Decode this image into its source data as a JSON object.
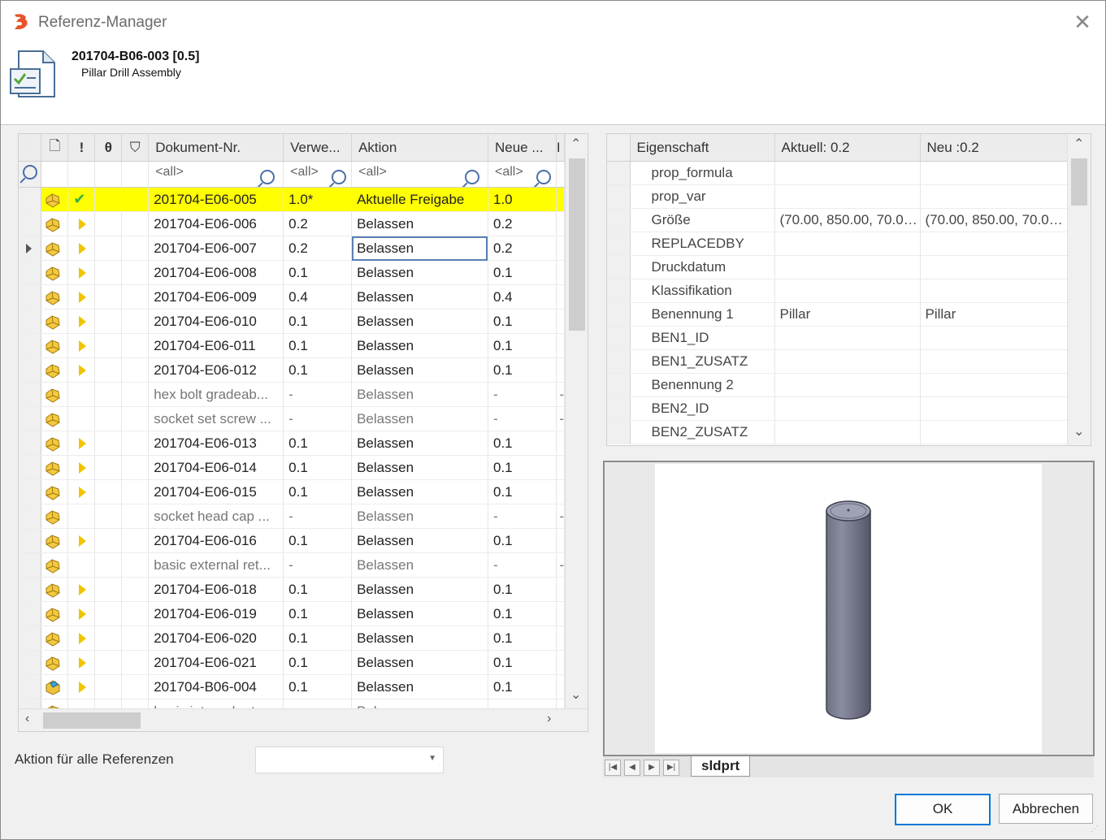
{
  "window": {
    "title": "Referenz-Manager",
    "close_glyph": "✕"
  },
  "header": {
    "document_number": "201704-B06-003 [0.5]",
    "document_name": "Pillar Drill Assembly"
  },
  "references_grid": {
    "columns": {
      "doc_icon": "🗋",
      "warn": "!",
      "lock": "θ",
      "filter": "⛉",
      "doc_nr": "Dokument-Nr.",
      "version": "Verwe...",
      "action": "Aktion",
      "new": "Neue ...",
      "extra": "I"
    },
    "filter": {
      "doc_nr": "<all>",
      "version": "<all>",
      "action": "<all>",
      "new": "<all>"
    },
    "rows": [
      {
        "doc_nr": "201704-E06-005",
        "version": "1.0*",
        "action": "Aktuelle Freigabe",
        "new": "1.0",
        "extra": "",
        "status": "check",
        "highlight": true,
        "current": false,
        "icon": "part-yellow",
        "dim": false
      },
      {
        "doc_nr": "201704-E06-006",
        "version": "0.2",
        "action": "Belassen",
        "new": "0.2",
        "extra": "",
        "status": "arrow",
        "highlight": false,
        "current": false,
        "icon": "part-yellow",
        "dim": false
      },
      {
        "doc_nr": "201704-E06-007",
        "version": "0.2",
        "action": "Belassen",
        "new": "0.2",
        "extra": "",
        "status": "arrow",
        "highlight": false,
        "current": true,
        "icon": "part-yellow",
        "dim": false
      },
      {
        "doc_nr": "201704-E06-008",
        "version": "0.1",
        "action": "Belassen",
        "new": "0.1",
        "extra": "",
        "status": "arrow",
        "highlight": false,
        "current": false,
        "icon": "part-yellow",
        "dim": false
      },
      {
        "doc_nr": "201704-E06-009",
        "version": "0.4",
        "action": "Belassen",
        "new": "0.4",
        "extra": "",
        "status": "arrow",
        "highlight": false,
        "current": false,
        "icon": "part-yellow",
        "dim": false
      },
      {
        "doc_nr": "201704-E06-010",
        "version": "0.1",
        "action": "Belassen",
        "new": "0.1",
        "extra": "",
        "status": "arrow",
        "highlight": false,
        "current": false,
        "icon": "part-yellow",
        "dim": false
      },
      {
        "doc_nr": "201704-E06-011",
        "version": "0.1",
        "action": "Belassen",
        "new": "0.1",
        "extra": "",
        "status": "arrow",
        "highlight": false,
        "current": false,
        "icon": "part-yellow",
        "dim": false
      },
      {
        "doc_nr": "201704-E06-012",
        "version": "0.1",
        "action": "Belassen",
        "new": "0.1",
        "extra": "",
        "status": "arrow",
        "highlight": false,
        "current": false,
        "icon": "part-yellow",
        "dim": false
      },
      {
        "doc_nr": "hex bolt gradeab...",
        "version": "-",
        "action": "Belassen",
        "new": "-",
        "extra": "-",
        "status": "",
        "highlight": false,
        "current": false,
        "icon": "part-yellow",
        "dim": true
      },
      {
        "doc_nr": "socket set screw ...",
        "version": "-",
        "action": "Belassen",
        "new": "-",
        "extra": "-",
        "status": "",
        "highlight": false,
        "current": false,
        "icon": "part-yellow",
        "dim": true
      },
      {
        "doc_nr": "201704-E06-013",
        "version": "0.1",
        "action": "Belassen",
        "new": "0.1",
        "extra": "",
        "status": "arrow",
        "highlight": false,
        "current": false,
        "icon": "part-yellow",
        "dim": false
      },
      {
        "doc_nr": "201704-E06-014",
        "version": "0.1",
        "action": "Belassen",
        "new": "0.1",
        "extra": "",
        "status": "arrow",
        "highlight": false,
        "current": false,
        "icon": "part-yellow",
        "dim": false
      },
      {
        "doc_nr": "201704-E06-015",
        "version": "0.1",
        "action": "Belassen",
        "new": "0.1",
        "extra": "",
        "status": "arrow",
        "highlight": false,
        "current": false,
        "icon": "part-yellow",
        "dim": false
      },
      {
        "doc_nr": "socket head cap ...",
        "version": "-",
        "action": "Belassen",
        "new": "-",
        "extra": "-",
        "status": "",
        "highlight": false,
        "current": false,
        "icon": "part-yellow",
        "dim": true
      },
      {
        "doc_nr": "201704-E06-016",
        "version": "0.1",
        "action": "Belassen",
        "new": "0.1",
        "extra": "",
        "status": "arrow",
        "highlight": false,
        "current": false,
        "icon": "part-yellow",
        "dim": false
      },
      {
        "doc_nr": "basic external ret...",
        "version": "-",
        "action": "Belassen",
        "new": "-",
        "extra": "-",
        "status": "",
        "highlight": false,
        "current": false,
        "icon": "part-yellow",
        "dim": true
      },
      {
        "doc_nr": "201704-E06-018",
        "version": "0.1",
        "action": "Belassen",
        "new": "0.1",
        "extra": "",
        "status": "arrow",
        "highlight": false,
        "current": false,
        "icon": "part-yellow",
        "dim": false
      },
      {
        "doc_nr": "201704-E06-019",
        "version": "0.1",
        "action": "Belassen",
        "new": "0.1",
        "extra": "",
        "status": "arrow",
        "highlight": false,
        "current": false,
        "icon": "part-yellow",
        "dim": false
      },
      {
        "doc_nr": "201704-E06-020",
        "version": "0.1",
        "action": "Belassen",
        "new": "0.1",
        "extra": "",
        "status": "arrow",
        "highlight": false,
        "current": false,
        "icon": "part-yellow",
        "dim": false
      },
      {
        "doc_nr": "201704-E06-021",
        "version": "0.1",
        "action": "Belassen",
        "new": "0.1",
        "extra": "",
        "status": "arrow",
        "highlight": false,
        "current": false,
        "icon": "part-yellow",
        "dim": false
      },
      {
        "doc_nr": "201704-B06-004",
        "version": "0.1",
        "action": "Belassen",
        "new": "0.1",
        "extra": "",
        "status": "arrow",
        "highlight": false,
        "current": false,
        "icon": "assembly-blue",
        "dim": false
      },
      {
        "doc_nr": "basic internal reta...",
        "version": "-",
        "action": "Belassen",
        "new": "-",
        "extra": "-",
        "status": "",
        "highlight": false,
        "current": false,
        "icon": "part-yellow",
        "dim": true
      }
    ]
  },
  "properties_grid": {
    "columns": {
      "property": "Eigenschaft",
      "current": "Aktuell: 0.2",
      "new": "Neu :0.2"
    },
    "rows": [
      {
        "property": "prop_formula",
        "current": "",
        "new": ""
      },
      {
        "property": "prop_var",
        "current": "",
        "new": ""
      },
      {
        "property": "Größe",
        "current": "(70.00, 850.00, 70.00...",
        "new": "(70.00, 850.00, 70.00..."
      },
      {
        "property": "REPLACEDBY",
        "current": "",
        "new": ""
      },
      {
        "property": "Druckdatum",
        "current": "",
        "new": ""
      },
      {
        "property": "Klassifikation",
        "current": "",
        "new": ""
      },
      {
        "property": "Benennung 1",
        "current": "Pillar",
        "new": "Pillar"
      },
      {
        "property": "BEN1_ID",
        "current": "",
        "new": ""
      },
      {
        "property": "BEN1_ZUSATZ",
        "current": "",
        "new": ""
      },
      {
        "property": "Benennung 2",
        "current": "",
        "new": ""
      },
      {
        "property": "BEN2_ID",
        "current": "",
        "new": ""
      },
      {
        "property": "BEN2_ZUSATZ",
        "current": "",
        "new": ""
      }
    ]
  },
  "preview": {
    "tab_label": "sldprt",
    "nav": [
      "first-icon",
      "prev-icon",
      "next-icon",
      "last-icon"
    ]
  },
  "footer": {
    "action_all_label": "Aktion für alle Referenzen",
    "action_all_value": "",
    "ok_label": "OK",
    "cancel_label": "Abbrechen"
  },
  "colors": {
    "highlight": "#ffff00",
    "accent": "#0078d7",
    "status_arrow": "#f1c400",
    "check": "#2eb34a"
  }
}
